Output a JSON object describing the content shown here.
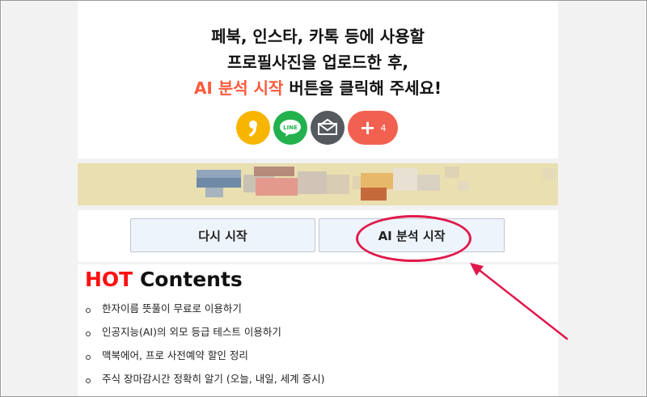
{
  "intro": {
    "line1": "페북, 인스타, 카톡 등에 사용할",
    "line2": "프로필사진을 업로드한 후,",
    "line3_accent": "AI 분석 시작",
    "line3_rest": " 버튼을 클릭해 주세요!"
  },
  "share": {
    "kakao_icon": "kakao-talk-icon",
    "line_label": "LINE",
    "mail_icon": "mail-icon",
    "more_count": "4"
  },
  "buttons": {
    "restart_label": "다시 시작",
    "analyze_label": "AI 분석 시작"
  },
  "hot": {
    "title_accent": "HOT",
    "title_rest": " Contents",
    "items": [
      "한자이름 뜻풀이 무료로 이용하기",
      "인공지능(AI)의 외모 등급 테스트 이용하기",
      "맥북에어, 프로 사전예약 할인 정리",
      "주식 장마감시간 정확히 알기 (오늘, 내일, 세계 증시)"
    ]
  },
  "colors": {
    "accent": "#ff5a3c",
    "hot": "#ff1010",
    "highlight": "#e0194b",
    "kakao": "#f7b500",
    "line": "#22b14c",
    "mail": "#555a5e",
    "more": "#f26150"
  }
}
